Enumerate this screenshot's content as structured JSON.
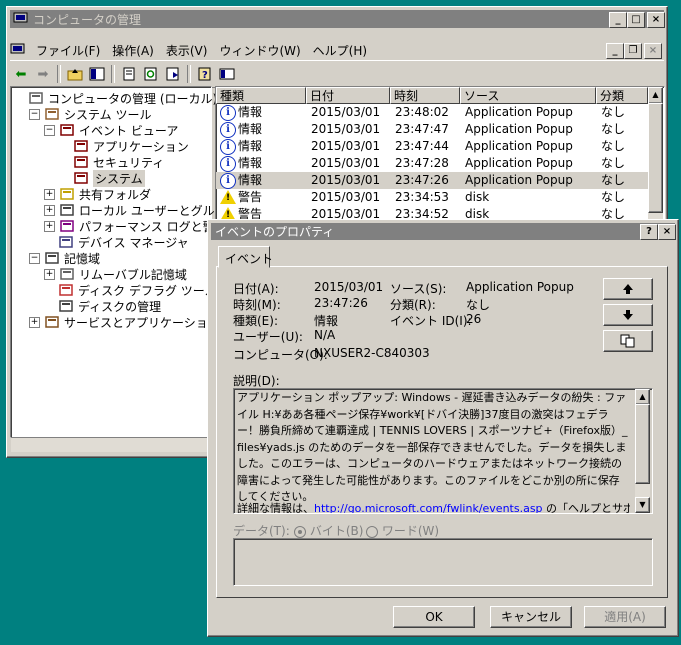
{
  "main_window": {
    "title": "コンピュータの管理",
    "menus": [
      "ファイル(F)",
      "操作(A)",
      "表示(V)",
      "ウィンドウ(W)",
      "ヘルプ(H)"
    ],
    "tree": [
      {
        "label": "コンピュータの管理 (ローカル)",
        "level": 0,
        "exp": "",
        "icon": "computer-icon"
      },
      {
        "label": "システム ツール",
        "level": 1,
        "exp": "−",
        "icon": "tools-icon"
      },
      {
        "label": "イベント ビューア",
        "level": 2,
        "exp": "−",
        "icon": "event-viewer-icon"
      },
      {
        "label": "アプリケーション",
        "level": 3,
        "exp": "",
        "icon": "log-icon"
      },
      {
        "label": "セキュリティ",
        "level": 3,
        "exp": "",
        "icon": "log-icon"
      },
      {
        "label": "システム",
        "level": 3,
        "exp": "",
        "icon": "log-icon",
        "selected": true
      },
      {
        "label": "共有フォルダ",
        "level": 2,
        "exp": "+",
        "icon": "folder-icon"
      },
      {
        "label": "ローカル ユーザーとグループ",
        "level": 2,
        "exp": "+",
        "icon": "users-icon"
      },
      {
        "label": "パフォーマンス ログと警告",
        "level": 2,
        "exp": "+",
        "icon": "perf-icon"
      },
      {
        "label": "デバイス マネージャ",
        "level": 2,
        "exp": "",
        "icon": "device-icon"
      },
      {
        "label": "記憶域",
        "level": 1,
        "exp": "−",
        "icon": "storage-icon"
      },
      {
        "label": "リムーバブル記憶域",
        "level": 2,
        "exp": "+",
        "icon": "removable-icon"
      },
      {
        "label": "ディスク デフラグ ツール",
        "level": 2,
        "exp": "",
        "icon": "defrag-icon"
      },
      {
        "label": "ディスクの管理",
        "level": 2,
        "exp": "",
        "icon": "disk-icon"
      },
      {
        "label": "サービスとアプリケーション",
        "level": 1,
        "exp": "+",
        "icon": "services-icon"
      }
    ],
    "columns": [
      "種類",
      "日付",
      "時刻",
      "ソース",
      "分類"
    ],
    "rows": [
      {
        "type": "情報",
        "kind": "info",
        "date": "2015/03/01",
        "time": "23:48:02",
        "source": "Application Popup",
        "cat": "なし"
      },
      {
        "type": "情報",
        "kind": "info",
        "date": "2015/03/01",
        "time": "23:47:47",
        "source": "Application Popup",
        "cat": "なし"
      },
      {
        "type": "情報",
        "kind": "info",
        "date": "2015/03/01",
        "time": "23:47:44",
        "source": "Application Popup",
        "cat": "なし"
      },
      {
        "type": "情報",
        "kind": "info",
        "date": "2015/03/01",
        "time": "23:47:28",
        "source": "Application Popup",
        "cat": "なし"
      },
      {
        "type": "情報",
        "kind": "info",
        "date": "2015/03/01",
        "time": "23:47:26",
        "source": "Application Popup",
        "cat": "なし",
        "selected": true
      },
      {
        "type": "警告",
        "kind": "warn",
        "date": "2015/03/01",
        "time": "23:34:53",
        "source": "disk",
        "cat": "なし"
      },
      {
        "type": "警告",
        "kind": "warn",
        "date": "2015/03/01",
        "time": "23:34:52",
        "source": "disk",
        "cat": "なし"
      }
    ]
  },
  "dialog": {
    "title": "イベントのプロパティ",
    "title_help": "?",
    "title_close": "×",
    "tab": "イベント",
    "date_label": "日付(A):",
    "date_value": "2015/03/01",
    "time_label": "時刻(M):",
    "time_value": "23:47:26",
    "type_label": "種類(E):",
    "type_value": "情報",
    "user_label": "ユーザー(U):",
    "user_value": "N/A",
    "computer_label": "コンピュータ(O):",
    "computer_value": "NXUSER2-C840303",
    "source_label": "ソース(S):",
    "source_value": "Application Popup",
    "category_label": "分類(R):",
    "category_value": "なし",
    "eventid_label": "イベント ID(I):",
    "eventid_value": "26",
    "description_label": "説明(D):",
    "description_text": "アプリケーション ポップアップ: Windows - 遅延書き込みデータの紛失 : ファイル H:¥ああ各種ページ保存¥work¥[ドバイ決勝]37度目の激突はフェデラー！勝負所締めて連覇達成 | TENNIS LOVERS | スポーツナビ+（Firefox版）_files¥yads.js のためのデータを一部保存できませんでした。データを損失しました。このエラーは、コンピュータのハードウェアまたはネットワーク接続の障害によって発生した可能性があります。このファイルをどこか別の所に保存してください。",
    "description_more_prefix": "詳細な情報は、",
    "description_link": "http://go.microsoft.com/fwlink/events.asp",
    "description_more_suffix": " の「ヘルプとサポート",
    "data_label": "データ(T):",
    "radio_bytes": "バイト(B)",
    "radio_words": "ワード(W)",
    "ok": "OK",
    "cancel": "キャンセル",
    "apply": "適用(A)",
    "up_arrow": "▲",
    "down_arrow": "▼"
  }
}
